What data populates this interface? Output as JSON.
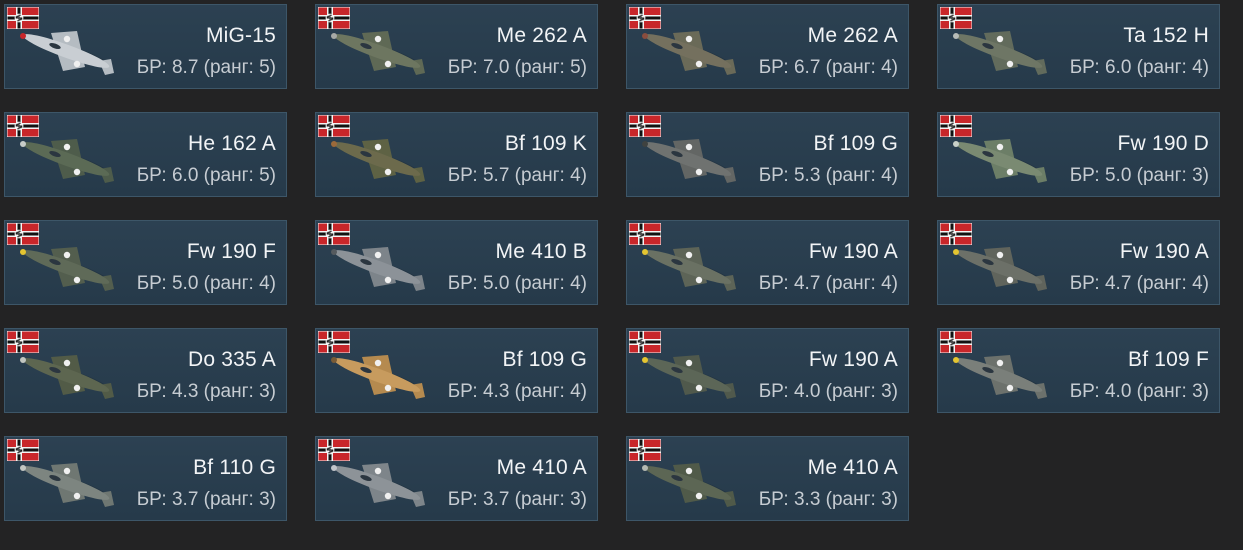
{
  "vehicles": [
    {
      "name": "MiG-15",
      "br": "БР: 8.7 (ранг: 5)",
      "icon": "mig-15-aircraft-icon",
      "body_color": "#c9ced3",
      "wing_color": "#b5bcc2",
      "accent": "#c8262a"
    },
    {
      "name": "Me 262 A",
      "br": "БР: 7.0 (ранг: 5)",
      "icon": "me-262-aircraft-icon",
      "body_color": "#6d7660",
      "wing_color": "#5f6955",
      "accent": "#a8aaa6"
    },
    {
      "name": "Me 262 A",
      "br": "БР: 6.7 (ранг: 4)",
      "icon": "me-262-aircraft-icon",
      "body_color": "#74705e",
      "wing_color": "#6a6a58",
      "accent": "#8a4d3e"
    },
    {
      "name": "Ta 152 H",
      "br": "БР: 6.0 (ранг: 4)",
      "icon": "ta-152-aircraft-icon",
      "body_color": "#6e7665",
      "wing_color": "#626b5c",
      "accent": "#b8bcb8"
    },
    {
      "name": "He 162 A",
      "br": "БР: 6.0 (ранг: 5)",
      "icon": "he-162-aircraft-icon",
      "body_color": "#5b6a55",
      "wing_color": "#4e5c4b",
      "accent": "#c8ccc8"
    },
    {
      "name": "Bf 109 K",
      "br": "БР: 5.7 (ранг: 4)",
      "icon": "bf-109-aircraft-icon",
      "body_color": "#6c6a4c",
      "wing_color": "#5e6244",
      "accent": "#9c6a3a"
    },
    {
      "name": "Bf 109 G",
      "br": "БР: 5.3 (ранг: 4)",
      "icon": "bf-109-aircraft-icon",
      "body_color": "#6f7270",
      "wing_color": "#636664",
      "accent": "#3f4240"
    },
    {
      "name": "Fw 190 D",
      "br": "БР: 5.0 (ранг: 3)",
      "icon": "fw-190-aircraft-icon",
      "body_color": "#7a8a72",
      "wing_color": "#6c7e67",
      "accent": "#c9d0c8"
    },
    {
      "name": "Fw 190 F",
      "br": "БР: 5.0 (ранг: 4)",
      "icon": "fw-190-aircraft-icon",
      "body_color": "#5f6a58",
      "wing_color": "#535e4e",
      "accent": "#e4c531"
    },
    {
      "name": "Me 410 B",
      "br": "БР: 5.0 (ранг: 4)",
      "icon": "me-410-aircraft-icon",
      "body_color": "#8c9298",
      "wing_color": "#7d848a",
      "accent": "#555a5e"
    },
    {
      "name": "Fw 190 A",
      "br": "БР: 4.7 (ранг: 4)",
      "icon": "fw-190-aircraft-icon",
      "body_color": "#6a7163",
      "wing_color": "#5d6457",
      "accent": "#e4c531"
    },
    {
      "name": "Fw 190 A",
      "br": "БР: 4.7 (ранг: 4)",
      "icon": "fw-190-aircraft-icon",
      "body_color": "#6c7068",
      "wing_color": "#60645c",
      "accent": "#e4c531"
    },
    {
      "name": "Do 335 A",
      "br": "БР: 4.3 (ранг: 3)",
      "icon": "do-335-aircraft-icon",
      "body_color": "#5d6650",
      "wing_color": "#525b47",
      "accent": "#c2c6c0"
    },
    {
      "name": "Bf 109 G",
      "br": "БР: 4.3 (ранг: 4)",
      "icon": "bf-109-aircraft-icon",
      "body_color": "#c79b5e",
      "wing_color": "#b58a4f",
      "accent": "#7a5c36"
    },
    {
      "name": "Fw 190 A",
      "br": "БР: 4.0 (ранг: 3)",
      "icon": "fw-190-aircraft-icon",
      "body_color": "#5c6657",
      "wing_color": "#50594c",
      "accent": "#e4c531"
    },
    {
      "name": "Bf 109 F",
      "br": "БР: 4.0 (ранг: 3)",
      "icon": "bf-109-aircraft-icon",
      "body_color": "#7a7f7a",
      "wing_color": "#6c716c",
      "accent": "#e4c531"
    },
    {
      "name": "Bf 110 G",
      "br": "БР: 3.7 (ранг: 3)",
      "icon": "bf-110-aircraft-icon",
      "body_color": "#7d8580",
      "wing_color": "#6f7772",
      "accent": "#c2c6c2"
    },
    {
      "name": "Me 410 A",
      "br": "БР: 3.7 (ранг: 3)",
      "icon": "me-410-aircraft-icon",
      "body_color": "#8d9398",
      "wing_color": "#7e858a",
      "accent": "#c2c6ca"
    },
    {
      "name": "Me 410 A",
      "br": "БР: 3.3 (ранг: 3)",
      "icon": "me-410-aircraft-icon",
      "body_color": "#5c6654",
      "wing_color": "#505a49",
      "accent": "#b5bab2"
    }
  ]
}
